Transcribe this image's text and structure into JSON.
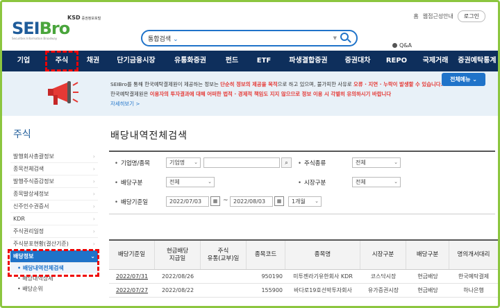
{
  "header": {
    "logo_ksd": "KSD",
    "logo_ksd_sub": "증권정보포털",
    "logo_text_a": "SEI",
    "logo_text_b": "Bro",
    "logo_sub": "Securities Information Broadway",
    "search_select": "통합검색",
    "qa": "Q&A",
    "home_label": "홈",
    "links_label": "웹접근성안내",
    "login_label": "로그인"
  },
  "nav": {
    "items": [
      "기업",
      "주식",
      "채권",
      "단기금융시장",
      "유통화증권",
      "펀드",
      "ETF",
      "파생결합증권",
      "증권대차",
      "REPO",
      "국제거래",
      "증권예탁통계"
    ]
  },
  "notice": {
    "line1_a": "SEIBro를 통해 한국예탁결제원이 제공하는 정보는 ",
    "line1_b": "단순히 정보의 제공을 목적",
    "line1_c": "으로 하고 있으며, 불가피한 사유로 ",
    "line1_d": "오류 · 지연 · 누락이 발생할 수 있습니다.",
    "line2_a": "한국예탁결제원은 ",
    "line2_b": "이용자의 투자결과에 대해 어떠한 법적 · 경제적 책임도 지지 않으므로 정보 이용 시 각별히 유의하시기 바랍니다",
    "more": "자세히보기 >",
    "all_menu": "전체메뉴 ⌄"
  },
  "sidebar": {
    "title": "주식",
    "items": [
      "발행회사총괄정보",
      "종목전체검색",
      "발행주식증감정보",
      "종목발상세정보",
      "신주인수권증서",
      "KDR",
      "주식권리일정",
      "주식분포현황(결산기준)"
    ],
    "active": "배당정보",
    "subs": [
      "배당내역전체검색",
      "배당내역상세",
      "배당순위"
    ]
  },
  "content": {
    "title": "배당내역전체검색",
    "filters": {
      "company_label": "기업명/종목",
      "company_select": "기업명",
      "stock_type_label": "주식종류",
      "stock_type_value": "전체",
      "div_type_label": "배당구분",
      "div_type_value": "전체",
      "market_label": "시장구분",
      "market_value": "전체",
      "date_label": "배당기준일",
      "date_from": "2022/07/03",
      "date_to": "2022/08/03",
      "date_tilde": "~",
      "period": "1개월"
    },
    "table": {
      "headers": [
        "배당기준일",
        "현금배당\n지급일",
        "주식\n유통(교부)일",
        "종목코드",
        "종목명",
        "시장구분",
        "배당구분",
        "명의개서대리"
      ],
      "rows": [
        [
          "2022/07/31",
          "2022/08/26",
          "",
          "950190",
          "미투젠라기유한회사 KDR",
          "코스닥시장",
          "현금배당",
          "한국예탁결제"
        ],
        [
          "2022/07/27",
          "2022/08/22",
          "",
          "155900",
          "바다로19호선박투자회사",
          "유가증권시장",
          "현금배당",
          "하나은행"
        ]
      ]
    }
  }
}
